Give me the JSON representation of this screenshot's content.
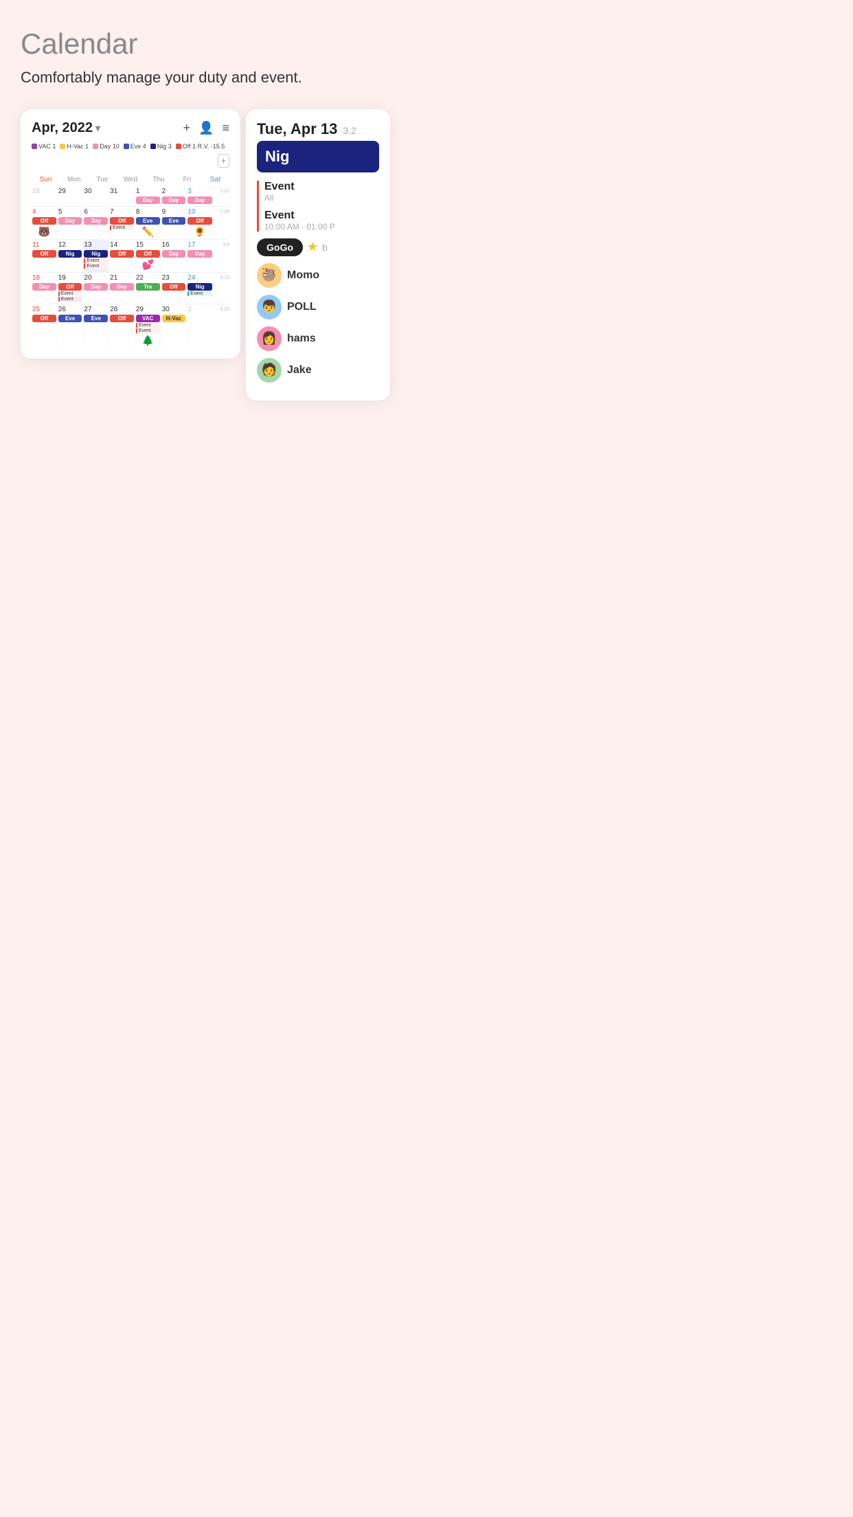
{
  "app": {
    "title": "Calendar",
    "subtitle": "Comfortably manage your duty and event."
  },
  "calendar": {
    "month_title": "Apr, 2022",
    "chevron": "▾",
    "add_btn": "+",
    "profile_btn": "👤",
    "menu_btn": "≡",
    "legend_add_btn": "+",
    "legend": [
      {
        "label": "VAC 1",
        "color": "#8e44ad"
      },
      {
        "label": "H-Vac 1",
        "color": "#f9c846"
      },
      {
        "label": "Day 10",
        "color": "#f48fb1"
      },
      {
        "label": "Eve 4",
        "color": "#3f51b5"
      },
      {
        "label": "Nig 3",
        "color": "#1a237e"
      },
      {
        "label": "Off 1 R.V. -15.5",
        "color": "#e74c3c"
      }
    ],
    "day_names": [
      "Sun",
      "Mon",
      "Tue",
      "Wed",
      "Thu",
      "Fri",
      "Sat"
    ],
    "weeks": [
      {
        "side": "",
        "days": [
          {
            "num": "28",
            "class": "other-month",
            "shift": null,
            "events": []
          },
          {
            "num": "29",
            "class": "",
            "shift": null,
            "events": []
          },
          {
            "num": "30",
            "class": "",
            "shift": null,
            "events": []
          },
          {
            "num": "31",
            "class": "",
            "shift": null,
            "events": []
          },
          {
            "num": "1",
            "class": "",
            "shift": "Day",
            "shift_type": "shift-day",
            "events": []
          },
          {
            "num": "2",
            "class": "",
            "shift": "Day",
            "shift_type": "shift-day",
            "events": []
          },
          {
            "num": "3",
            "class": "saturday",
            "shift": "Day",
            "shift_type": "shift-day",
            "events": [],
            "week_count": "2.22"
          }
        ]
      },
      {
        "side": "",
        "days": [
          {
            "num": "4",
            "class": "sunday highlight-red",
            "shift": "Off",
            "shift_type": "shift-off",
            "events": [],
            "sticker": "🐻"
          },
          {
            "num": "5",
            "class": "",
            "shift": "Day",
            "shift_type": "shift-day",
            "events": []
          },
          {
            "num": "6",
            "class": "",
            "shift": "Day",
            "shift_type": "shift-day",
            "events": []
          },
          {
            "num": "7",
            "class": "",
            "shift": "Off",
            "shift_type": "shift-off",
            "events": [
              {
                "label": "Event",
                "type": "event-badge"
              }
            ]
          },
          {
            "num": "8",
            "class": "",
            "shift": "Eve",
            "shift_type": "shift-eve",
            "events": [],
            "sticker": "✏️"
          },
          {
            "num": "9",
            "class": "",
            "shift": "Eve",
            "shift_type": "shift-eve",
            "events": []
          },
          {
            "num": "10",
            "class": "saturday",
            "shift": "Off",
            "shift_type": "shift-off",
            "events": [],
            "sticker": "🌻",
            "week_count": "2.29"
          }
        ]
      },
      {
        "side": "",
        "days": [
          {
            "num": "11",
            "class": "sunday highlight-red",
            "shift": "Off",
            "shift_type": "shift-off",
            "events": []
          },
          {
            "num": "12",
            "class": "",
            "shift": "Nig",
            "shift_type": "shift-nig",
            "events": []
          },
          {
            "num": "13",
            "class": "",
            "shift": "Nig",
            "shift_type": "shift-nig",
            "events": [
              {
                "label": "Event",
                "type": "event-badge"
              },
              {
                "label": "Event",
                "type": "event-badge"
              }
            ]
          },
          {
            "num": "14",
            "class": "",
            "shift": "Off",
            "shift_type": "shift-off",
            "events": []
          },
          {
            "num": "15",
            "class": "",
            "shift": "Off",
            "shift_type": "shift-off",
            "events": [],
            "sticker": "💕"
          },
          {
            "num": "16",
            "class": "",
            "shift": "Day",
            "shift_type": "shift-day",
            "events": []
          },
          {
            "num": "17",
            "class": "saturday",
            "shift": "Day",
            "shift_type": "shift-day",
            "events": [],
            "week_count": "3.6"
          }
        ]
      },
      {
        "side": "",
        "days": [
          {
            "num": "18",
            "class": "sunday highlight-red",
            "shift": "Day",
            "shift_type": "shift-day",
            "events": []
          },
          {
            "num": "19",
            "class": "",
            "shift": "Off",
            "shift_type": "shift-off",
            "events": [
              {
                "label": "Event",
                "type": "event-badge"
              },
              {
                "label": "Event",
                "type": "event-badge"
              }
            ]
          },
          {
            "num": "20",
            "class": "",
            "shift": "Day",
            "shift_type": "shift-day",
            "events": []
          },
          {
            "num": "21",
            "class": "",
            "shift": "Day",
            "shift_type": "shift-day",
            "events": []
          },
          {
            "num": "22",
            "class": "",
            "shift": "Tra",
            "shift_type": "shift-tra",
            "events": []
          },
          {
            "num": "23",
            "class": "",
            "shift": "Off",
            "shift_type": "shift-off",
            "events": []
          },
          {
            "num": "24",
            "class": "saturday",
            "shift": "Nig",
            "shift_type": "shift-nig",
            "events": [
              {
                "label": "Event",
                "type": "event-badge-teal"
              }
            ],
            "week_count": "3.13"
          }
        ]
      },
      {
        "side": "",
        "days": [
          {
            "num": "25",
            "class": "sunday highlight-red",
            "shift": "Off",
            "shift_type": "shift-off",
            "events": []
          },
          {
            "num": "26",
            "class": "",
            "shift": "Eve",
            "shift_type": "shift-eve",
            "events": []
          },
          {
            "num": "27",
            "class": "",
            "shift": "Eve",
            "shift_type": "shift-eve",
            "events": []
          },
          {
            "num": "28",
            "class": "",
            "shift": "Off",
            "shift_type": "shift-off",
            "events": []
          },
          {
            "num": "29",
            "class": "",
            "shift": "VAC",
            "shift_type": "shift-vac",
            "events": [
              {
                "label": "Event",
                "type": "event-badge"
              },
              {
                "label": "Event",
                "type": "event-badge"
              }
            ],
            "sticker": "🌲"
          },
          {
            "num": "30",
            "class": "",
            "shift": "H-Vac",
            "shift_type": "shift-hvac",
            "events": []
          },
          {
            "num": "1",
            "class": "other-month",
            "shift": null,
            "events": [],
            "week_count": "3.20"
          }
        ]
      }
    ]
  },
  "right_panel": {
    "date": "Tue, Apr 13",
    "date_sub": "3.2",
    "shift_label": "Nig",
    "events": [
      {
        "title": "Event",
        "sub": "All",
        "type": "all"
      },
      {
        "title": "Event",
        "sub": "10:00 AM - 01:00 P",
        "type": "timed"
      }
    ],
    "tag": "GoGo",
    "users": [
      {
        "name": "Momo",
        "avatar": "avatar-momo",
        "emoji": "🦥"
      },
      {
        "name": "POLL",
        "avatar": "avatar-poll",
        "emoji": "👦"
      },
      {
        "name": "hams",
        "avatar": "avatar-hams",
        "emoji": "👩"
      },
      {
        "name": "Jake",
        "avatar": "avatar-jake",
        "emoji": "🧑"
      }
    ]
  }
}
